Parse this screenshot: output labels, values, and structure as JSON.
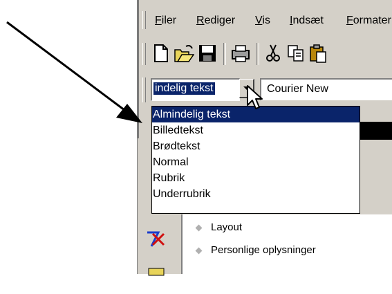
{
  "menubar": {
    "items": [
      "Filer",
      "Rediger",
      "Vis",
      "Indsæt",
      "Formater"
    ]
  },
  "toolbar": {
    "buttons": [
      "new-document-icon",
      "open-folder-icon",
      "save-icon",
      "print-icon",
      "cut-icon",
      "copy-icon",
      "paste-icon"
    ]
  },
  "formatbar": {
    "style_value": "indelig tekst",
    "font_value": "Courier New"
  },
  "style_dropdown": {
    "options": [
      "Almindelig tekst",
      "Billedtekst",
      "Brødtekst",
      "Normal",
      "Rubrik",
      "Underrubrik"
    ],
    "selected_index": 0
  },
  "outline_list": {
    "items": [
      "Layout",
      "Personlige oplysninger"
    ]
  },
  "colors": {
    "selection": "#0a246a",
    "chrome": "#d4d0c8"
  }
}
